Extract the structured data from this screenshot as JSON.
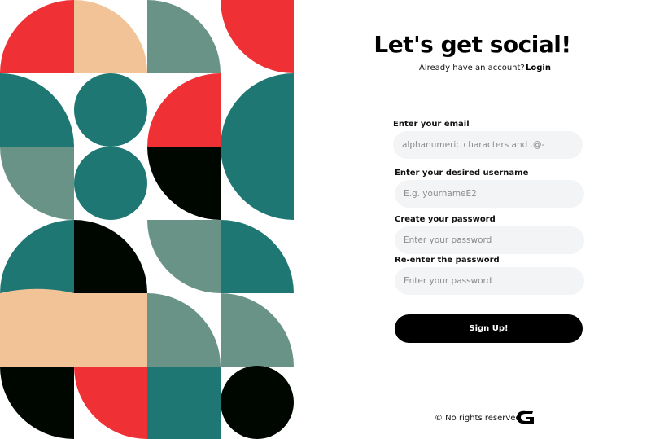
{
  "colors": {
    "red": "#ef3034",
    "peach": "#f3c398",
    "sage": "#6a9387",
    "teal": "#1e7773",
    "black": "#000600",
    "input_bg": "#f3f4f6"
  },
  "heading": "Let's get social!",
  "account_prompt": "Already have an account?",
  "login_link": "Login",
  "form": {
    "email_label": "Enter your email",
    "email_placeholder": "alphanumeric characters and .@-",
    "username_label": "Enter your desired username",
    "username_placeholder": "E.g. yournameE2",
    "password_label": "Create your password",
    "password_placeholder": "Enter your password",
    "repassword_label": "Re-enter the password",
    "repassword_placeholder": "Enter your password",
    "submit_label": "Sign Up!"
  },
  "footer": {
    "copyright": "© No rights reserved.",
    "logo_icon": "brand-logo-icon"
  }
}
